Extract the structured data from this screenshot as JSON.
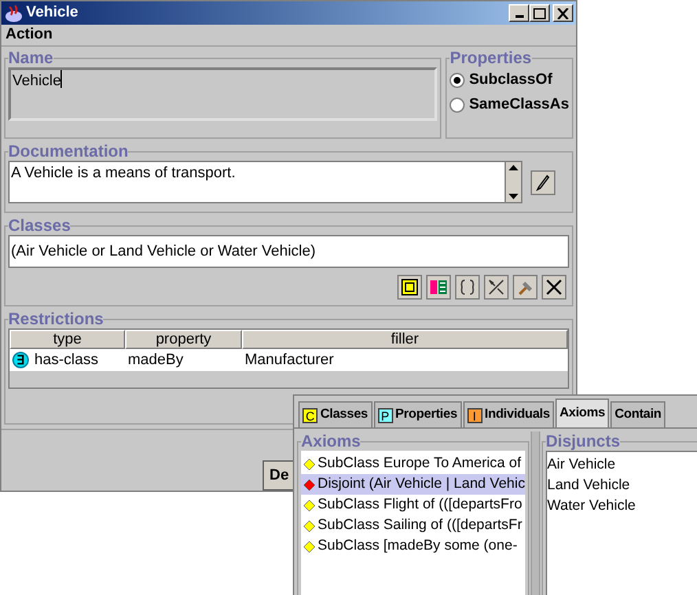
{
  "window": {
    "title": "Vehicle"
  },
  "menu": [
    "Action"
  ],
  "name": {
    "legend": "Name",
    "value": "Vehicle"
  },
  "properties": {
    "legend": "Properties",
    "options": [
      {
        "label": "SubclassOf",
        "selected": true
      },
      {
        "label": "SameClassAs",
        "selected": false
      }
    ]
  },
  "documentation": {
    "legend": "Documentation",
    "value": "A Vehicle is a means of transport."
  },
  "classes": {
    "legend": "Classes",
    "value": "(Air Vehicle or Land Vehicle or Water Vehicle)"
  },
  "restrictions": {
    "legend": "Restrictions",
    "columns": [
      "type",
      "property",
      "filler"
    ],
    "rows": [
      {
        "symbol": "∃",
        "type": "has-class",
        "property": "madeBy",
        "filler": "Manufacturer"
      }
    ]
  },
  "buttons": [
    "De"
  ],
  "panel": {
    "tabs": [
      {
        "label": "Classes",
        "badge": "C",
        "color": "#ffff00",
        "selected": false
      },
      {
        "label": "Properties",
        "badge": "P",
        "color": "#80ffff",
        "selected": false
      },
      {
        "label": "Individuals",
        "badge": "I",
        "color": "#ff9933",
        "selected": false
      },
      {
        "label": "Axioms",
        "selected": true
      },
      {
        "label": "Contain",
        "selected": false
      }
    ],
    "axioms": {
      "legend": "Axioms",
      "items": [
        {
          "text": "SubClass Europe To America of",
          "color": "#ffff00",
          "selected": false
        },
        {
          "text": "Disjoint (Air Vehicle | Land Vehic",
          "color": "#ff0000",
          "selected": true
        },
        {
          "text": "SubClass Flight of (([departsFro",
          "color": "#ffff00",
          "selected": false
        },
        {
          "text": "SubClass Sailing of (([departsFr",
          "color": "#ffff00",
          "selected": false
        },
        {
          "text": "SubClass [madeBy some (one-",
          "color": "#ffff00",
          "selected": false
        }
      ]
    },
    "disjuncts": {
      "legend": "Disjuncts",
      "items": [
        "Air Vehicle",
        "Land Vehicle",
        "Water Vehicle"
      ]
    }
  }
}
